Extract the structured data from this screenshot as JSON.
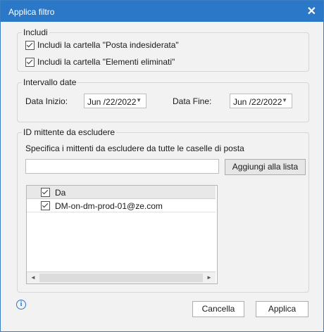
{
  "window": {
    "title": "Applica filtro",
    "close_glyph": "✕"
  },
  "includi": {
    "legend": "Includi",
    "items": [
      {
        "label": "Includi la cartella \"Posta indesiderata\"",
        "checked": true
      },
      {
        "label": "Includi la cartella \"Elementi eliminati\"",
        "checked": true
      }
    ]
  },
  "intervallo": {
    "legend": "Intervallo date",
    "start_label": "Data Inizio:",
    "start_value": "Jun /22/2022",
    "end_label": "Data Fine:",
    "end_value": "Jun /22/2022"
  },
  "mittente": {
    "legend": "ID mittente da escludere",
    "instruction": "Specifica i mittenti da escludere da tutte le caselle di posta",
    "input_value": "",
    "add_button": "Aggiungi alla lista",
    "list_header": "Da",
    "rows": [
      {
        "label": "DM-on-dm-prod-01@ze.com",
        "checked": true
      }
    ],
    "scroll_left": "◄",
    "scroll_right": "►"
  },
  "footer": {
    "info_icon": "i",
    "cancel": "Cancella",
    "apply": "Applica"
  },
  "colors": {
    "title_bar": "#2b78c8",
    "background": "#f2f2f2"
  }
}
